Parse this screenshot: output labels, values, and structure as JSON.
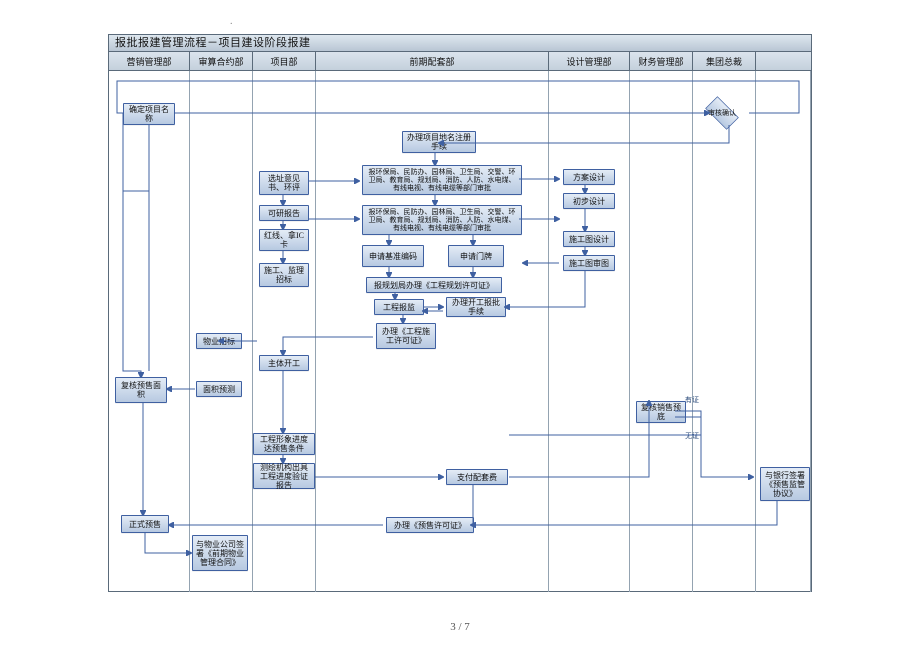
{
  "page": {
    "number": "3 / 7"
  },
  "diagram": {
    "title": "报批报建管理流程－项目建设阶段报建",
    "lanes": [
      "营销管理部",
      "审算合约部",
      "项目部",
      "前期配套部",
      "设计管理部",
      "财务管理部",
      "集团总裁",
      ""
    ],
    "notes": {
      "yes": "有证",
      "no": "无证"
    },
    "nodes": {
      "n0": "确定项目名称",
      "pA": "选址意见书、环评",
      "pB": "可研报告",
      "pC": "红线、拿IC卡",
      "pD": "施工、监理招标",
      "q1": "办理项目地名注册手续",
      "q2": "报环保局、民防办、园林局、卫生局、交警、环卫局、教育局、规划局、消防、人防、水电煤、有线电视、有线电缆等部门审批",
      "q3": "报环保局、民防办、园林局、卫生局、交警、环卫局、教育局、规划局、消防、人防、水电煤、有线电视、有线电缆等部门审批",
      "q4a": "申请基准编码",
      "q4b": "申请门牌",
      "q5": "报规划局办理《工程规划许可证》",
      "q6a": "工程报监",
      "q6b": "办理开工报批手续",
      "q7": "办理《工程施工许可证》",
      "q8": "办理《预售许可证》",
      "d1": "方案设计",
      "d2": "初步设计",
      "d3": "施工图设计",
      "d4": "施工图审图",
      "p2a": "物业招标",
      "p2b": "主体开工",
      "n1": "复核预售面积",
      "n2": "面积预测",
      "n3": "正式预售",
      "p3a": "工程形象进度达预售条件",
      "p3b": "测绘机构出具工程进度验证报告",
      "p4": "与物业公司签署《前期物业管理合同》",
      "q9": "支付配套费",
      "fw": "复核销售预底",
      "gz": "审核确认",
      "bank": "与银行签署《预售监管协议》"
    }
  }
}
